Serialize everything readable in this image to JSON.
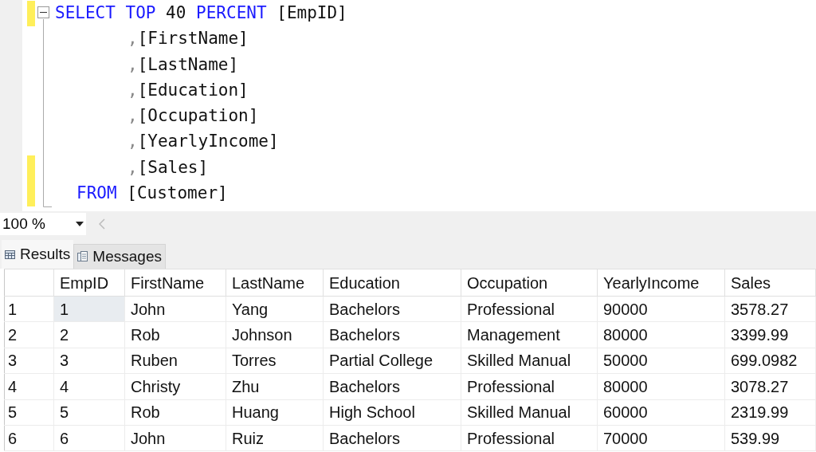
{
  "editor": {
    "lines": [
      {
        "kind": "head",
        "changed": true,
        "tokens": [
          {
            "text": "SELECT",
            "kind": "keyword"
          },
          {
            "text": "TOP",
            "kind": "keyword"
          },
          {
            "text": "40",
            "kind": "plain"
          },
          {
            "text": "PERCENT",
            "kind": "keyword"
          },
          {
            "text": "[EmpID]",
            "kind": "plain"
          }
        ]
      },
      {
        "kind": "column",
        "changed": false,
        "tokens": [
          {
            "text": ",",
            "kind": "punct"
          },
          {
            "text": "[FirstName]",
            "kind": "plain"
          }
        ]
      },
      {
        "kind": "column",
        "changed": false,
        "tokens": [
          {
            "text": ",",
            "kind": "punct"
          },
          {
            "text": "[LastName]",
            "kind": "plain"
          }
        ]
      },
      {
        "kind": "column",
        "changed": false,
        "tokens": [
          {
            "text": ",",
            "kind": "punct"
          },
          {
            "text": "[Education]",
            "kind": "plain"
          }
        ]
      },
      {
        "kind": "column",
        "changed": false,
        "tokens": [
          {
            "text": ",",
            "kind": "punct"
          },
          {
            "text": "[Occupation]",
            "kind": "plain"
          }
        ]
      },
      {
        "kind": "column",
        "changed": false,
        "tokens": [
          {
            "text": ",",
            "kind": "punct"
          },
          {
            "text": "[YearlyIncome]",
            "kind": "plain"
          }
        ]
      },
      {
        "kind": "column",
        "changed": true,
        "tokens": [
          {
            "text": ",",
            "kind": "punct"
          },
          {
            "text": "[Sales]",
            "kind": "plain"
          }
        ]
      },
      {
        "kind": "from",
        "changed": true,
        "tokens": [
          {
            "text": "FROM",
            "kind": "keyword"
          },
          {
            "text": "[Customer]",
            "kind": "plain"
          }
        ]
      }
    ]
  },
  "zoom": {
    "value": "100 %"
  },
  "tabs": [
    {
      "label": "Results",
      "kind": "grid",
      "selected": true
    },
    {
      "label": "Messages",
      "kind": "messages",
      "selected": false
    }
  ],
  "table": {
    "columns": [
      "EmpID",
      "FirstName",
      "LastName",
      "Education",
      "Occupation",
      "YearlyIncome",
      "Sales"
    ],
    "rows": [
      {
        "number": "1",
        "focused": true,
        "cells": [
          "1",
          "John",
          "Yang",
          "Bachelors",
          "Professional",
          "90000",
          "3578.27"
        ]
      },
      {
        "number": "2",
        "focused": false,
        "cells": [
          "2",
          "Rob",
          "Johnson",
          "Bachelors",
          "Management",
          "80000",
          "3399.99"
        ]
      },
      {
        "number": "3",
        "focused": false,
        "cells": [
          "3",
          "Ruben",
          "Torres",
          "Partial College",
          "Skilled Manual",
          "50000",
          "699.0982"
        ]
      },
      {
        "number": "4",
        "focused": false,
        "cells": [
          "4",
          "Christy",
          "Zhu",
          "Bachelors",
          "Professional",
          "80000",
          "3078.27"
        ]
      },
      {
        "number": "5",
        "focused": false,
        "cells": [
          "5",
          "Rob",
          "Huang",
          "High School",
          "Skilled Manual",
          "60000",
          "2319.99"
        ]
      },
      {
        "number": "6",
        "focused": false,
        "cells": [
          "6",
          "John",
          "Ruiz",
          "Bachelors",
          "Professional",
          "70000",
          "539.99"
        ]
      }
    ]
  }
}
